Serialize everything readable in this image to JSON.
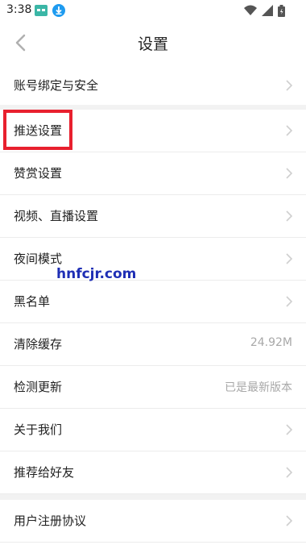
{
  "status_bar": {
    "time": "3:38",
    "icons": [
      "app-notification-icon",
      "download-icon",
      "wifi-icon",
      "signal-icon",
      "battery-icon"
    ]
  },
  "header": {
    "title": "设置",
    "back_icon": "chevron-left-icon"
  },
  "items": [
    {
      "label": "账号绑定与安全",
      "value": ""
    },
    {
      "label": "推送设置",
      "value": ""
    },
    {
      "label": "赞赏设置",
      "value": ""
    },
    {
      "label": "视频、直播设置",
      "value": ""
    },
    {
      "label": "夜间模式",
      "value": ""
    },
    {
      "label": "黑名单",
      "value": ""
    },
    {
      "label": "清除缓存",
      "value": "24.92M"
    },
    {
      "label": "检测更新",
      "value": "已是最新版本"
    },
    {
      "label": "关于我们",
      "value": ""
    },
    {
      "label": "推荐给好友",
      "value": ""
    },
    {
      "label": "用户注册协议",
      "value": ""
    }
  ],
  "watermark": "hnfcjr.com",
  "colors": {
    "highlight": "#e8202e",
    "watermark": "#1f2fb5",
    "section_gap": "#f2f2f2",
    "secondary_text": "#a8a8a8"
  }
}
